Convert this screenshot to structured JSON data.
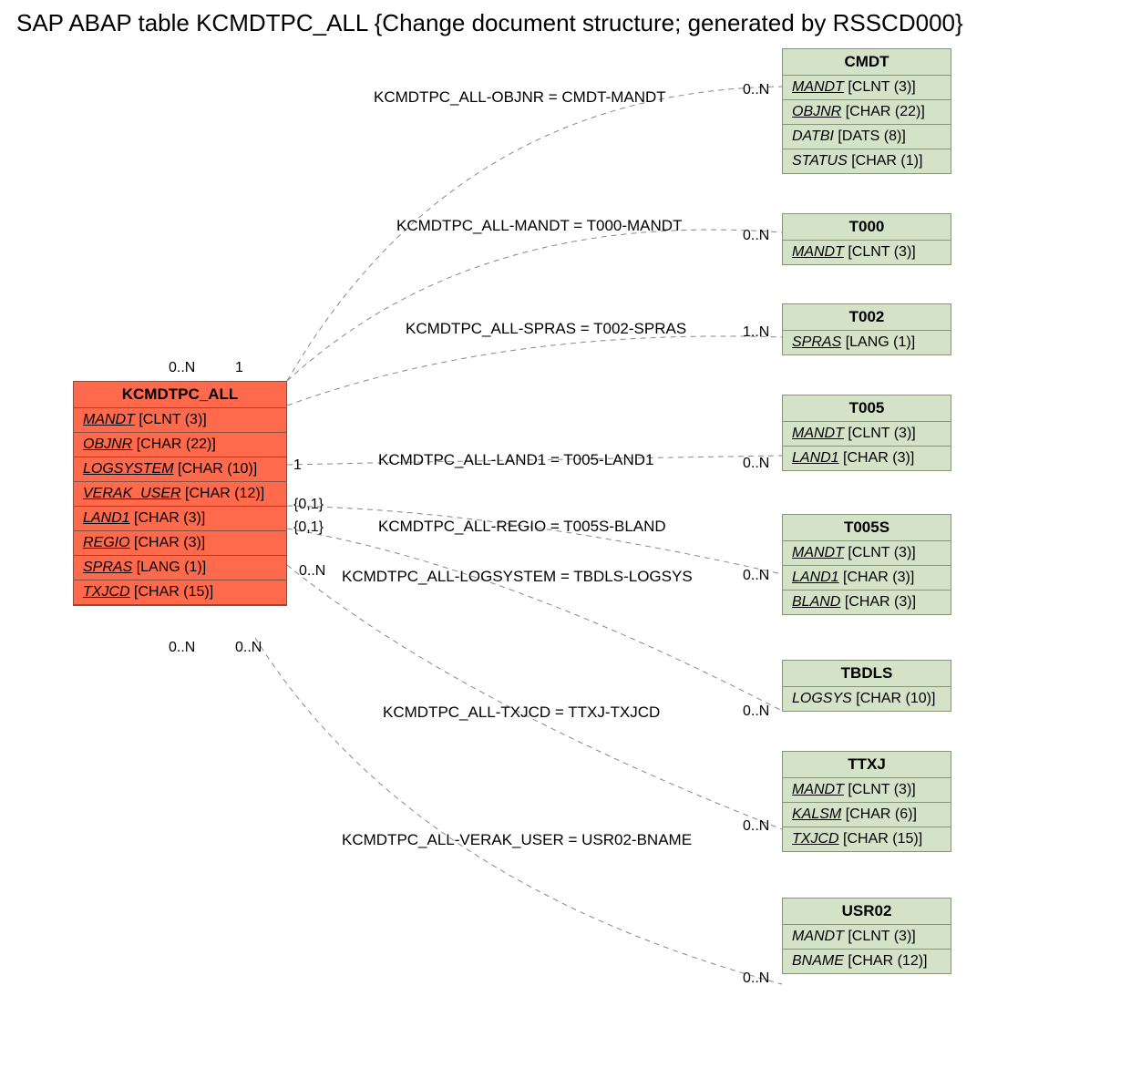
{
  "title": "SAP ABAP table KCMDTPC_ALL {Change document structure; generated by RSSCD000}",
  "main_entity": {
    "name": "KCMDTPC_ALL",
    "fields": [
      {
        "name": "MANDT",
        "type": "[CLNT (3)]"
      },
      {
        "name": "OBJNR",
        "type": "[CHAR (22)]"
      },
      {
        "name": "LOGSYSTEM",
        "type": "[CHAR (10)]"
      },
      {
        "name": "VERAK_USER",
        "type": "[CHAR (12)]"
      },
      {
        "name": "LAND1",
        "type": "[CHAR (3)]"
      },
      {
        "name": "REGIO",
        "type": "[CHAR (3)]"
      },
      {
        "name": "SPRAS",
        "type": "[LANG (1)]"
      },
      {
        "name": "TXJCD",
        "type": "[CHAR (15)]"
      }
    ]
  },
  "related": {
    "CMDT": {
      "name": "CMDT",
      "fields": [
        {
          "name": "MANDT",
          "type": "[CLNT (3)]"
        },
        {
          "name": "OBJNR",
          "type": "[CHAR (22)]"
        },
        {
          "name": "DATBI",
          "type": "[DATS (8)]",
          "nounder": true
        },
        {
          "name": "STATUS",
          "type": "[CHAR (1)]",
          "nounder": true
        }
      ]
    },
    "T000": {
      "name": "T000",
      "fields": [
        {
          "name": "MANDT",
          "type": "[CLNT (3)]"
        }
      ]
    },
    "T002": {
      "name": "T002",
      "fields": [
        {
          "name": "SPRAS",
          "type": "[LANG (1)]"
        }
      ]
    },
    "T005": {
      "name": "T005",
      "fields": [
        {
          "name": "MANDT",
          "type": "[CLNT (3)]"
        },
        {
          "name": "LAND1",
          "type": "[CHAR (3)]"
        }
      ]
    },
    "T005S": {
      "name": "T005S",
      "fields": [
        {
          "name": "MANDT",
          "type": "[CLNT (3)]"
        },
        {
          "name": "LAND1",
          "type": "[CHAR (3)]"
        },
        {
          "name": "BLAND",
          "type": "[CHAR (3)]"
        }
      ]
    },
    "TBDLS": {
      "name": "TBDLS",
      "fields": [
        {
          "name": "LOGSYS",
          "type": "[CHAR (10)]",
          "nounder": true
        }
      ]
    },
    "TTXJ": {
      "name": "TTXJ",
      "fields": [
        {
          "name": "MANDT",
          "type": "[CLNT (3)]"
        },
        {
          "name": "KALSM",
          "type": "[CHAR (6)]"
        },
        {
          "name": "TXJCD",
          "type": "[CHAR (15)]"
        }
      ]
    },
    "USR02": {
      "name": "USR02",
      "fields": [
        {
          "name": "MANDT",
          "type": "[CLNT (3)]",
          "nounder": true
        },
        {
          "name": "BNAME",
          "type": "[CHAR (12)]",
          "nounder": true
        }
      ]
    }
  },
  "relations": [
    {
      "label": "KCMDTPC_ALL-OBJNR = CMDT-MANDT",
      "left_card": "0..N",
      "right_card": "0..N"
    },
    {
      "label": "KCMDTPC_ALL-MANDT = T000-MANDT",
      "left_card": "1",
      "right_card": "0..N"
    },
    {
      "label": "KCMDTPC_ALL-SPRAS = T002-SPRAS",
      "left_card": "",
      "right_card": "1..N"
    },
    {
      "label": "KCMDTPC_ALL-LAND1 = T005-LAND1",
      "left_card": "1",
      "right_card": "0..N"
    },
    {
      "label": "KCMDTPC_ALL-REGIO = T005S-BLAND",
      "left_card": "{0,1}",
      "right_card": ""
    },
    {
      "label": "KCMDTPC_ALL-LOGSYSTEM = TBDLS-LOGSYS",
      "left_card": "{0,1}",
      "right_card": "0..N"
    },
    {
      "label": "KCMDTPC_ALL-TXJCD = TTXJ-TXJCD",
      "left_card": "0..N",
      "right_card": "0..N"
    },
    {
      "label": "KCMDTPC_ALL-VERAK_USER = USR02-BNAME",
      "left_card": "0..N",
      "right_card": "0..N"
    },
    {
      "label": "",
      "left_card": "0..N",
      "right_card": "0..N"
    }
  ]
}
